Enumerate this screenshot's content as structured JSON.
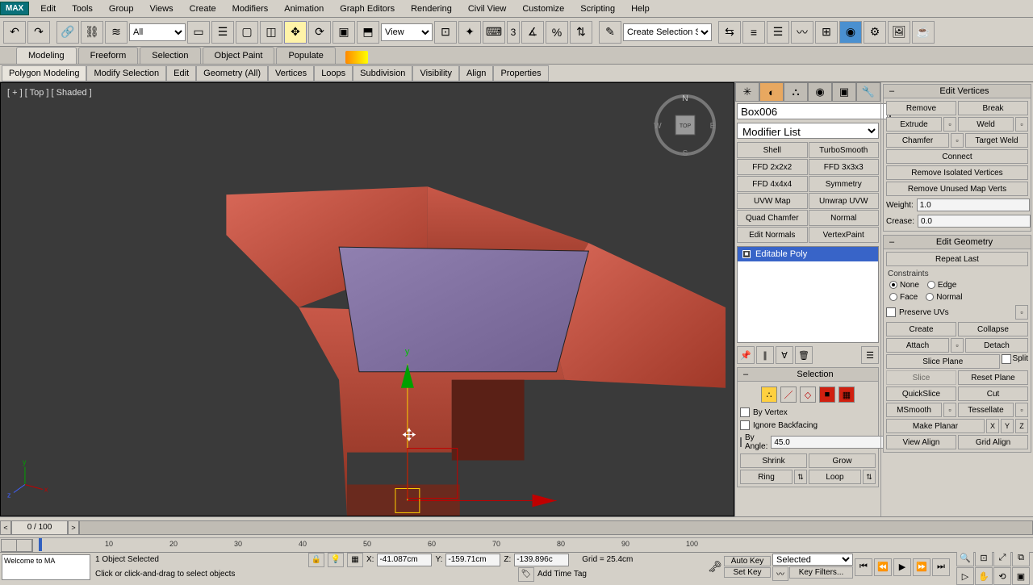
{
  "menu": {
    "logo": "MAX",
    "items": [
      "Edit",
      "Tools",
      "Group",
      "Views",
      "Create",
      "Modifiers",
      "Animation",
      "Graph Editors",
      "Rendering",
      "Civil View",
      "Customize",
      "Scripting",
      "Help"
    ]
  },
  "toolbar": {
    "filter": "All",
    "refcoord": "View",
    "named_sel": "Create Selection Se",
    "three": "3"
  },
  "ribbon_tabs": [
    "Modeling",
    "Freeform",
    "Selection",
    "Object Paint",
    "Populate"
  ],
  "ribbon_buttons": [
    "Polygon Modeling",
    "Modify Selection",
    "Edit",
    "Geometry (All)",
    "Vertices",
    "Loops",
    "Subdivision",
    "Visibility",
    "Align",
    "Properties"
  ],
  "viewport": {
    "label": "[ + ] [ Top ] [ Shaded ]",
    "gizmo_y": "y",
    "viewcube": {
      "n": "N",
      "s": "S",
      "w": "W",
      "e": "E",
      "face": "TOP"
    }
  },
  "cmd": {
    "object_name": "Box006",
    "modifier_list": "Modifier List",
    "modifier_buttons": [
      "Shell",
      "TurboSmooth",
      "FFD 2x2x2",
      "FFD 3x3x3",
      "FFD 4x4x4",
      "Symmetry",
      "UVW Map",
      "Unwrap UVW",
      "Quad Chamfer",
      "Normal",
      "Edit Normals",
      "VertexPaint"
    ],
    "stack_item": "Editable Poly"
  },
  "selection": {
    "title": "Selection",
    "by_vertex": "By Vertex",
    "ignore_backfacing": "Ignore Backfacing",
    "by_angle": "By Angle:",
    "angle_val": "45.0",
    "shrink": "Shrink",
    "grow": "Grow",
    "ring": "Ring",
    "loop": "Loop"
  },
  "edit_vertices": {
    "title": "Edit Vertices",
    "remove": "Remove",
    "break": "Break",
    "extrude": "Extrude",
    "weld": "Weld",
    "chamfer": "Chamfer",
    "target_weld": "Target Weld",
    "connect": "Connect",
    "remove_iso": "Remove Isolated Vertices",
    "remove_unused": "Remove Unused Map Verts",
    "weight": "Weight:",
    "weight_val": "1.0",
    "crease": "Crease:",
    "crease_val": "0.0"
  },
  "edit_geom": {
    "title": "Edit Geometry",
    "repeat": "Repeat Last",
    "constraints": "Constraints",
    "none": "None",
    "edge": "Edge",
    "face": "Face",
    "normal": "Normal",
    "preserve_uvs": "Preserve UVs",
    "create": "Create",
    "collapse": "Collapse",
    "attach": "Attach",
    "detach": "Detach",
    "slice_plane": "Slice Plane",
    "split": "Split",
    "slice": "Slice",
    "reset_plane": "Reset Plane",
    "quickslice": "QuickSlice",
    "cut": "Cut",
    "msmooth": "MSmooth",
    "tessellate": "Tessellate",
    "make_planar": "Make Planar",
    "x": "X",
    "y": "Y",
    "z": "Z",
    "view_align": "View Align",
    "grid_align": "Grid Align"
  },
  "timeline": {
    "frame": "0 / 100",
    "ticks": [
      "10",
      "20",
      "30",
      "40",
      "50",
      "60",
      "70",
      "80",
      "90",
      "100"
    ]
  },
  "status": {
    "welcome": "Welcome to MA",
    "sel": "1 Object Selected",
    "prompt": "Click or click-and-drag to select objects",
    "x": "X:",
    "xv": "-41.087cm",
    "y": "Y:",
    "yv": "-159.71cm",
    "z": "Z:",
    "zv": "-139.896c",
    "grid": "Grid = 25.4cm",
    "auto_key": "Auto Key",
    "set_key": "Set Key",
    "key_target": "Selected",
    "key_filters": "Key Filters...",
    "add_tag": "Add Time Tag"
  }
}
